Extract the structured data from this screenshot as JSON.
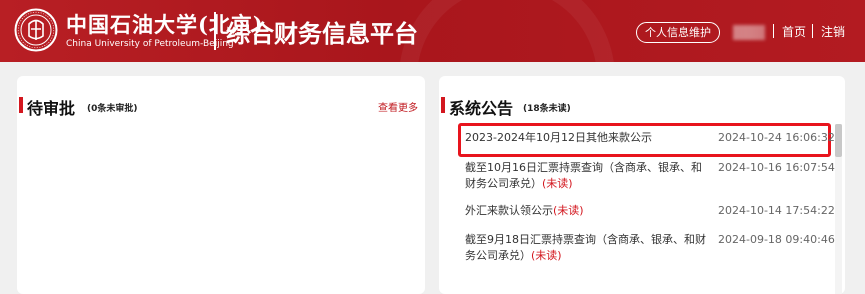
{
  "header": {
    "university_cn": "中国石油大学(北京)",
    "university_en": "China University of Petroleum-Beijing",
    "system_title": "综合财务信息平台",
    "profile_button": "个人信息维护",
    "separator": "|",
    "home_link": "首页",
    "logout_link": "注销"
  },
  "pending": {
    "title": "待审批",
    "count": "(0条未审批)",
    "see_more": "查看更多"
  },
  "notices": {
    "title": "系统公告",
    "count": "(18条未读)",
    "items": [
      {
        "title": "2023-2024年10月12日其他来款公示",
        "unread": "",
        "time": "2024-10-24 16:06:32"
      },
      {
        "title": "截至10月16日汇票持票查询（含商承、银承、和财务公司承兑）",
        "unread": "(未读)",
        "time": "2024-10-16 16:07:54"
      },
      {
        "title": "外汇来款认领公示",
        "unread": "(未读)",
        "time": "2024-10-14 17:54:22"
      },
      {
        "title": "截至9月18日汇票持票查询（含商承、银承、和财务公司承兑）",
        "unread": "(未读)",
        "time": "2024-09-18 09:40:46"
      }
    ]
  },
  "colors": {
    "brand_red": "#b81f24",
    "accent_red": "#d3171f",
    "highlight_red": "#e8141d"
  }
}
